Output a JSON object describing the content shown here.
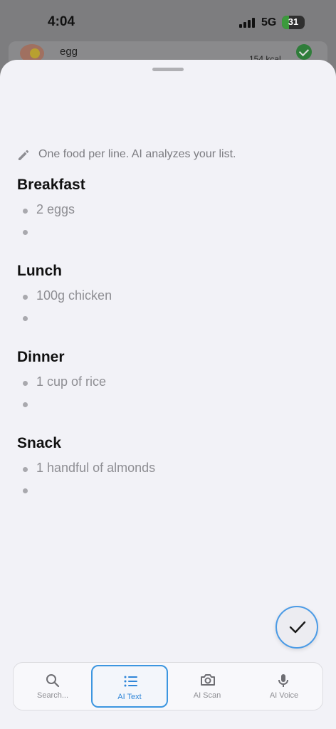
{
  "status_bar": {
    "time": "4:04",
    "network": "5G",
    "battery": "31"
  },
  "background_row": {
    "label": "egg",
    "kcal": "154 kcal"
  },
  "sheet": {
    "hint": "One food per line. AI analyzes your list.",
    "sections": [
      {
        "title": "Breakfast",
        "items": [
          "2 eggs",
          ""
        ]
      },
      {
        "title": "Lunch",
        "items": [
          "100g chicken",
          ""
        ]
      },
      {
        "title": "Dinner",
        "items": [
          "1 cup of rice",
          ""
        ]
      },
      {
        "title": "Snack",
        "items": [
          "1 handful of almonds",
          ""
        ]
      }
    ]
  },
  "tabs": [
    {
      "label": "Search...",
      "icon": "search-icon",
      "active": false
    },
    {
      "label": "AI Text",
      "icon": "list-icon",
      "active": true
    },
    {
      "label": "AI Scan",
      "icon": "camera-icon",
      "active": false
    },
    {
      "label": "AI Voice",
      "icon": "microphone-icon",
      "active": false
    }
  ],
  "colors": {
    "accent": "#3c96e0",
    "sheet_background": "#f2f2f7",
    "battery_fill": "#3c9a3c"
  }
}
